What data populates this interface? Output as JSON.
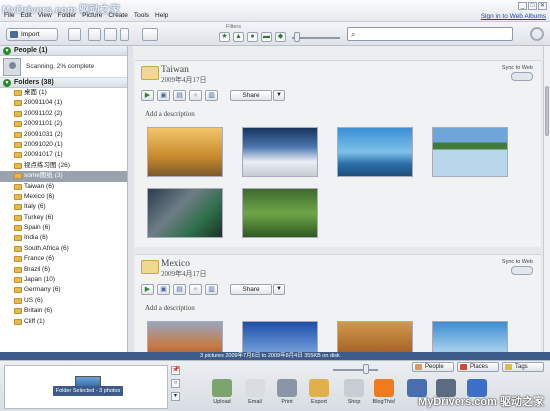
{
  "window": {
    "watermark_top": "MyDrivers.com 驱动之家",
    "signin_link": "Sign in to Web Albums",
    "controls": [
      "_",
      "□",
      "✕"
    ]
  },
  "menu": [
    "File",
    "Edit",
    "View",
    "Folder",
    "Picture",
    "Create",
    "Tools",
    "Help"
  ],
  "toolbar": {
    "import_label": "Import",
    "filters_label": "Filters",
    "filter_icons": [
      "★",
      "▲",
      "●",
      "▬",
      "◆"
    ],
    "search": {
      "value": "",
      "placeholder": ""
    }
  },
  "people": {
    "header": "People (1)",
    "status": "Scanning, 2% complete"
  },
  "folders": {
    "header": "Folders (38)",
    "items": [
      "桌面 (1)",
      "20091104 (1)",
      "20091102 (2)",
      "20091101 (2)",
      "20091031 (2)",
      "20091020 (1)",
      "20091017 (1)",
      "视点练习图 (26)",
      "some图纸 (3)",
      "Taiwan (6)",
      "Mexico (6)",
      "Italy (6)",
      "Turkey (6)",
      "Spain (6)",
      "India (6)",
      "South Africa (6)",
      "France (6)",
      "Brazil (6)",
      "Japan (10)",
      "Germany (6)",
      "US (6)",
      "Britain (6)",
      "Cliff (1)"
    ],
    "selected_index": 8
  },
  "albums": [
    {
      "title": "Taiwan",
      "date": "2009年4月17日",
      "sync_label": "Sync to Web",
      "share_label": "Share",
      "description_placeholder": "Add a description",
      "photos": [
        "pier-sunset",
        "sea-of-clouds",
        "coastal-rock",
        "rice-terrace",
        "gorge-road",
        "green-hills"
      ]
    },
    {
      "title": "Mexico",
      "date": "2009年4月17日",
      "sync_label": "Sync to Web",
      "share_label": "Share",
      "description_placeholder": "Add a description",
      "photos": [
        "red-rocks",
        "pyramid-sky",
        "stone-carving",
        "palm-beach"
      ]
    }
  ],
  "status_bar": {
    "text": "3 pictures    2009年7月6日 to 2009年8月4日    355KB on disk"
  },
  "tag_buttons": [
    "People",
    "Places",
    "Tags"
  ],
  "tray": {
    "selection_label": "Folder Selected - 3 photos"
  },
  "actions": [
    "Upload",
    "Email",
    "Print",
    "Export",
    "Shop",
    "BlogThis!",
    "Collage",
    "Movie",
    "Geo-Tag"
  ],
  "watermark_bottom": "MyDrivers.com 驱动之家",
  "colors": {
    "accent": "#3d5b8a",
    "selected_folder": "#9aa2ad",
    "link": "#1846b5",
    "folder_icon": "#e8b94a"
  }
}
